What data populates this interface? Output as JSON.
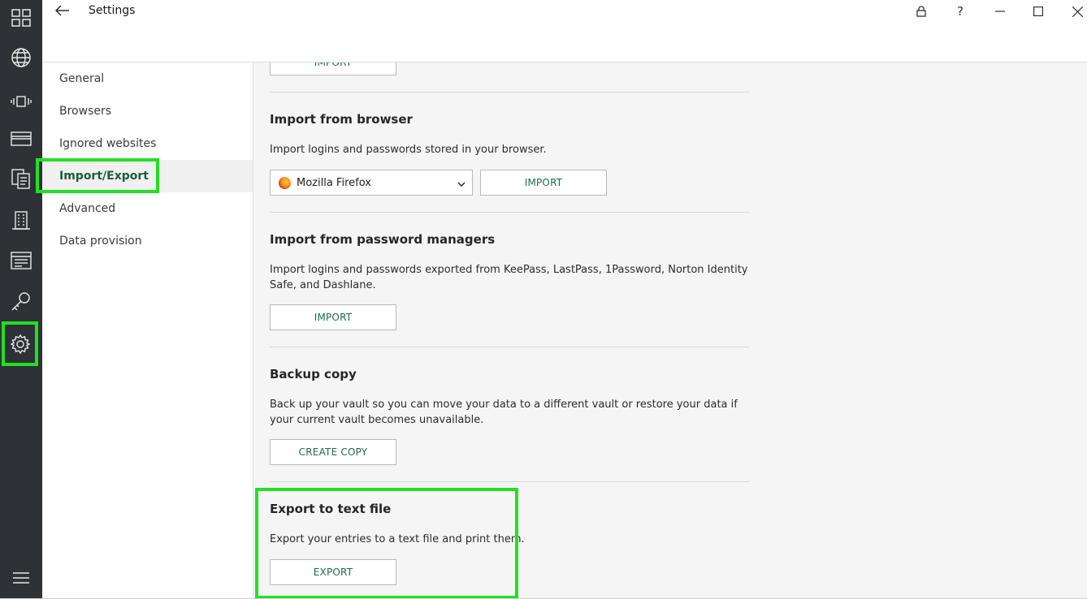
{
  "window": {
    "title": "Settings",
    "controls": [
      "lock-icon",
      "help-icon",
      "minimize-icon",
      "maximize-icon",
      "close-icon"
    ],
    "help_glyph": "?"
  },
  "rail": {
    "icons": [
      "dashboard-icon",
      "globe-icon",
      "vibrate-icon",
      "card-icon",
      "documents-icon",
      "building-icon",
      "notes-icon",
      "key-icon",
      "gear-icon",
      "menu-icon"
    ],
    "active": "gear-icon"
  },
  "nav": {
    "items": [
      {
        "label": "General"
      },
      {
        "label": "Browsers"
      },
      {
        "label": "Ignored websites"
      },
      {
        "label": "Import/Export"
      },
      {
        "label": "Advanced"
      },
      {
        "label": "Data provision"
      }
    ],
    "active": "Import/Export"
  },
  "content": {
    "top_button": "IMPORT",
    "browser": {
      "title": "Import from browser",
      "desc": "Import logins and passwords stored in your browser.",
      "selected": "Mozilla Firefox",
      "button": "IMPORT"
    },
    "managers": {
      "title": "Import from password managers",
      "desc": "Import logins and passwords exported from KeePass, LastPass, 1Password, Norton Identity Safe, and Dashlane.",
      "button": "IMPORT"
    },
    "backup": {
      "title": "Backup copy",
      "desc": "Back up your vault so you can move your data to a different vault or restore your data if your current vault becomes unavailable.",
      "button": "CREATE COPY"
    },
    "export": {
      "title": "Export to text file",
      "desc": "Export your entries to a text file and print them.",
      "button": "EXPORT"
    }
  },
  "colors": {
    "rail_bg": "#2e3236",
    "accent": "#1e6b4a",
    "highlight": "#22e022",
    "content_bg": "#f5f5f5"
  }
}
